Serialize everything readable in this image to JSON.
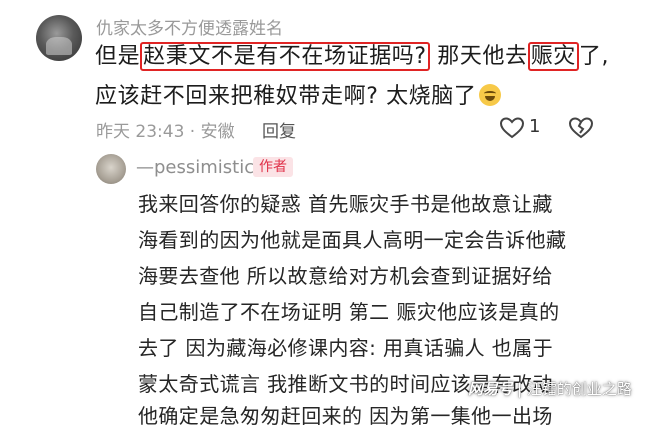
{
  "comment": {
    "username": "仇家太多不方便透露姓名",
    "line1": {
      "p1": "但是",
      "h1": "赵秉文不是有不在场证据吗?",
      "p2": " 那天他去",
      "h2": "赈灾",
      "p3": "了,"
    },
    "line2": "应该赶不回来把稚奴带走啊? 太烧脑了",
    "emoji": "grinning-sweat-emoji",
    "meta": "昨天 23:43 · 安徽",
    "reply_label": "回复",
    "like_count": "1",
    "highlight_color": "#e02424"
  },
  "reply": {
    "username": "—pessimistic",
    "author_tag": "作者",
    "author_tag_color": "#e0324a",
    "lines": [
      "我来回答你的疑惑 首先赈灾手书是他故意让藏",
      "海看到的因为他就是面具人高明一定会告诉他藏",
      "海要去查他 所以故意给对方机会查到证据好给",
      "自己制造了不在场证明  第二 赈灾他应该是真的",
      "去了 因为藏海必修课内容: 用真话骗人 也属于",
      "蒙太奇式谎言 我推断文书的时间应该是有改动",
      "他确定是急匆匆赶回来的 因为第一集他一出场"
    ]
  },
  "watermark": {
    "logo": "网易号",
    "text": "汪镭的创业之路"
  }
}
